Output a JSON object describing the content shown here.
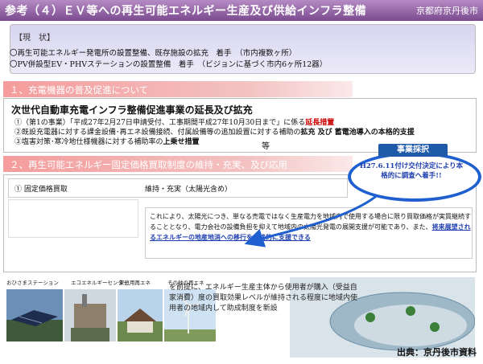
{
  "header": {
    "title": "参考（４）ＥＶ等への再生可能エネルギー生産及び供給インフラ整備",
    "org": "京都府京丹後市"
  },
  "status": {
    "label": "【現　状】",
    "lines": [
      "〇再生可能エネルギー発電所の設置整備、既存施設の拡充　着手　（市内複数ヶ所）",
      "〇PV併設型EV・PHVステーションの設置整備　着手　（ビジョンに基づく市内6ヶ所12器）"
    ]
  },
  "section1": {
    "heading": "１、充電機器の普及促進について",
    "lead": "次世代自動車充電インフラ整備促進事業の延長及び拡充",
    "items": [
      {
        "pre": "①（第1の事業）「平成27年2月27日申請受付、工事期間平成27年10月30日まで」に係る",
        "bold": "延長措置",
        "post": ""
      },
      {
        "pre": "②既設充電器に対する課金設備･再エネ設備接続、付属設備等の追加設置に対する補助の",
        "bold": "拡充 及び 蓄電池導入の本格的支援",
        "post": ""
      },
      {
        "pre": "③塩害対策･寒冷地仕様機器に対する補助率の",
        "bold": "上乗せ措置",
        "post": ""
      }
    ],
    "etc": "等"
  },
  "callout": {
    "tag": "事業採択",
    "text": "H27.6.11付け交付決定により本格的に調査へ着手!!"
  },
  "section2": {
    "heading": "２、再生可能エネルギー固定価格買取制度の維持・充実、及び応用",
    "row_left": "① 固定価格買取",
    "row_right": "維持・充実（太陽光含め）",
    "desc_pre": "これにより、太陽光につき、単なる売電ではなく生産電力を地域内で使用する場合に限り買取価格が実質継続することとなり、電力会社の設備負担を抑えて地域内の太陽光発電の展開支援が可能であり、また、",
    "desc_hl": "将来展望されるエネルギーの地産地消への移行を本格的に支援できる"
  },
  "photos": {
    "labels": [
      "おひさまステーション",
      "エコエネルギーセンター",
      "家庭用再エネ",
      "その他の再エネ"
    ]
  },
  "bottom": {
    "text": "を前提に、エネルギー生産主体から使用者が購入（受益自家消費）度の買取効果レベルが維持される程度に地域内使用者の地域内して助成制度を新設"
  },
  "source": "出典：京丹後市資料"
}
